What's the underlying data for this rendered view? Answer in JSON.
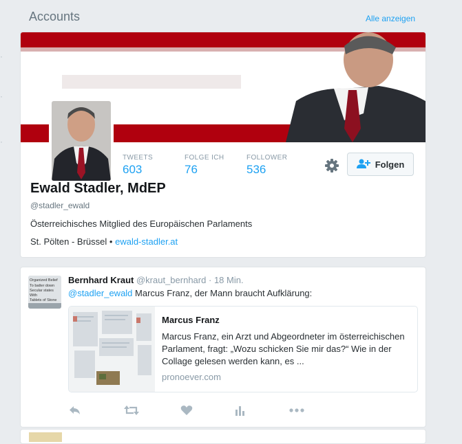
{
  "section": {
    "title": "Accounts",
    "show_all": "Alle anzeigen"
  },
  "profile": {
    "name": "Ewald Stadler, MdEP",
    "handle": "@stadler_ewald",
    "bio": "Österreichisches Mitglied des Europäischen Parlaments",
    "location": "St. Pölten - Brüssel",
    "separator": "•",
    "website": "ewald-stadler.at",
    "stats": [
      {
        "label": "TWEETS",
        "value": "603"
      },
      {
        "label": "FOLGE ICH",
        "value": "76"
      },
      {
        "label": "FOLLOWER",
        "value": "536"
      }
    ],
    "follow_label": "Folgen"
  },
  "tweet": {
    "author_name": "Bernhard Kraut",
    "author_handle": "@kraut_bernhard",
    "dot": "·",
    "time": "18 Min.",
    "mention": "@stadler_ewald",
    "text": " Marcus Franz, der Mann braucht Aufklärung:",
    "avatar_text": [
      "Organized Belief",
      "To batter down",
      "Secular states",
      "With",
      "Tablets of Stone"
    ],
    "card": {
      "title": "Marcus Franz",
      "description": "Marcus Franz, ein Arzt und Abgeordneter im österreichischen Parlament, fragt: „Wozu schicken Sie mir das?“ Wie in der Collage gelesen werden kann, es ...",
      "domain": "pronoever.com"
    }
  },
  "colors": {
    "accent": "#1da1f2",
    "banner_red": "#b0000e"
  },
  "icons": [
    "gear-icon",
    "add-user-icon",
    "reply-icon",
    "retweet-icon",
    "like-icon",
    "analytics-icon",
    "more-icon"
  ]
}
